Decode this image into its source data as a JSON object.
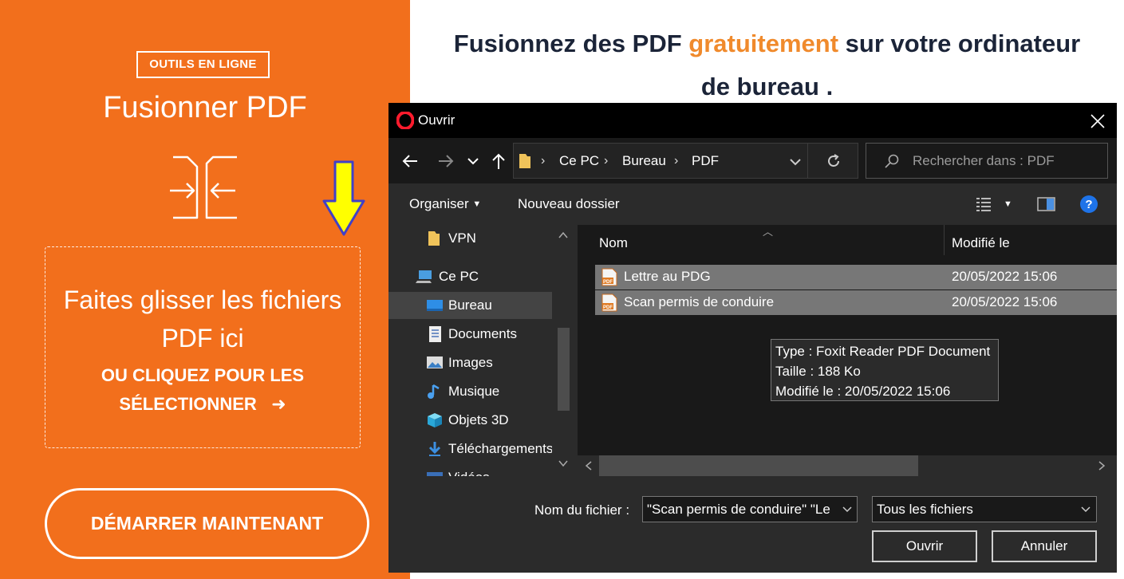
{
  "left_panel": {
    "badge": "OUTILS EN LIGNE",
    "title": "Fusionner PDF",
    "drop_line1": "Faites glisser les fichiers",
    "drop_line2": "PDF ici",
    "drop_cta_line1": "OU CLIQUEZ POUR LES",
    "drop_cta_line2": "SÉLECTIONNER",
    "drop_cta_arrow": "➜",
    "start_button": "DÉMARRER MAINTENANT",
    "bg_color": "#f26f1c"
  },
  "headline": {
    "part1": "Fusionnez des PDF ",
    "accent": "gratuitement",
    "part2": " sur votre ordinateur",
    "line2": "de bureau ."
  },
  "dialog": {
    "title": "Ouvrir",
    "breadcrumb": [
      "Ce PC",
      "Bureau",
      "PDF"
    ],
    "search_placeholder": "Rechercher dans : PDF",
    "toolbar": {
      "organize": "Organiser",
      "new_folder": "Nouveau dossier"
    },
    "nav_items": [
      {
        "label": "VPN",
        "icon": "folder-icon"
      },
      {
        "label": "Ce PC",
        "icon": "computer-icon"
      },
      {
        "label": "Bureau",
        "icon": "desktop-icon",
        "selected": true
      },
      {
        "label": "Documents",
        "icon": "documents-icon"
      },
      {
        "label": "Images",
        "icon": "images-icon"
      },
      {
        "label": "Musique",
        "icon": "music-icon"
      },
      {
        "label": "Objets 3D",
        "icon": "cube-icon"
      },
      {
        "label": "Téléchargements",
        "icon": "download-icon"
      },
      {
        "label": "Vidéos",
        "icon": "video-icon"
      }
    ],
    "columns": [
      "Nom",
      "Modifié le"
    ],
    "files": [
      {
        "name": "Lettre au PDG",
        "modified": "20/05/2022 15:06"
      },
      {
        "name": "Scan permis de conduire",
        "modified": "20/05/2022 15:06"
      }
    ],
    "tooltip": {
      "type": "Type : Foxit Reader PDF Document",
      "size": "Taille : 188 Ko",
      "modified": "Modifié le : 20/05/2022 15:06"
    },
    "filename_label": "Nom du fichier :",
    "filename_value": "\"Scan permis de conduire\" \"Le",
    "filetype_value": "Tous les fichiers",
    "open_button": "Ouvrir",
    "cancel_button": "Annuler"
  }
}
